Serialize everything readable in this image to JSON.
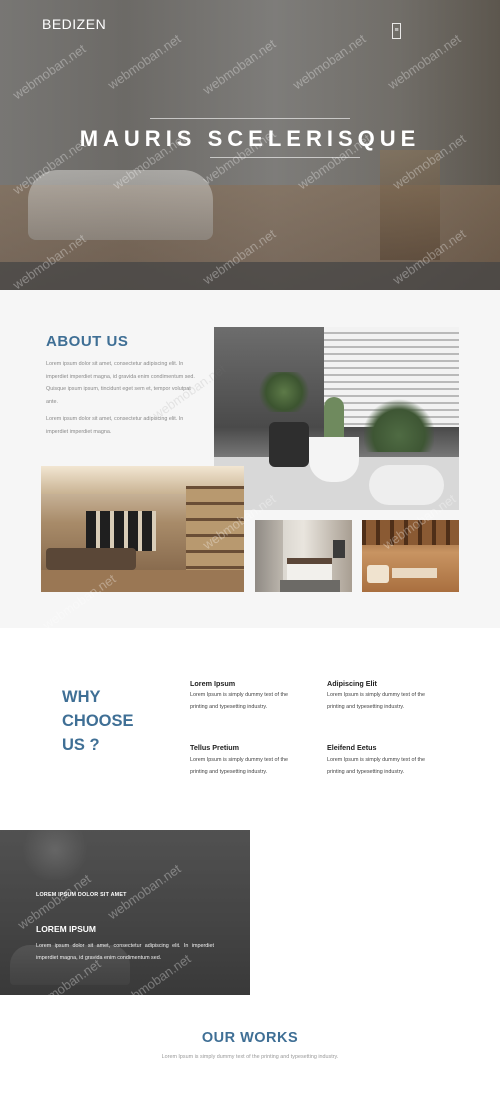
{
  "header": {
    "brand": "BEDIZEN",
    "menu_icon": "menu-toggle-icon",
    "menu_glyph": "≡"
  },
  "hero": {
    "title": "MAURIS SCELERISQUE"
  },
  "about": {
    "title": "ABOUT US",
    "paragraph1": "Lorem ipsum dolor sit amet, consectetur adipiscing elit. In imperdiet imperdiet magna, id gravida enim condimentum sed. Quisque ipsum ipsum, tincidunt eget sem et, tempor volutpat ante.",
    "paragraph2": "Lorem ipsum dolor sit amet, consectetur adipiscing elit. In imperdiet imperdiet magna."
  },
  "why": {
    "title_line1": "WHY",
    "title_line2": "CHOOSE",
    "title_line3": "US ?",
    "features": [
      {
        "title": "Lorem Ipsum",
        "text": "Lorem Ipsum is simply dummy text of the printing and typesetting industry."
      },
      {
        "title": "Adipiscing Elit",
        "text": "Lorem Ipsum is simply dummy text of the printing and typesetting industry."
      },
      {
        "title": "Tellus Pretium",
        "text": "Lorem Ipsum is simply dummy text of the printing and typesetting industry."
      },
      {
        "title": "Eleifend Eetus",
        "text": "Lorem Ipsum is simply dummy text of the printing and typesetting industry."
      }
    ]
  },
  "dark_block": {
    "kicker": "LOREM IPSUM DOLOR SIT AMET",
    "title": "LOREM IPSUM",
    "text": "Lorem ipsum dolor sit amet, consectetur adipiscing elit. In imperdiet imperdiet magna, id gravida enim condimentum sed."
  },
  "works": {
    "title": "OUR WORKS",
    "subtitle": "Lorem Ipsum is simply dummy text of the printing and typesetting industry."
  },
  "watermark": "webmoban.net",
  "colors": {
    "accent": "#3f6f95",
    "about_bg": "#f6f6f6",
    "text_muted": "#8a8a8a"
  }
}
